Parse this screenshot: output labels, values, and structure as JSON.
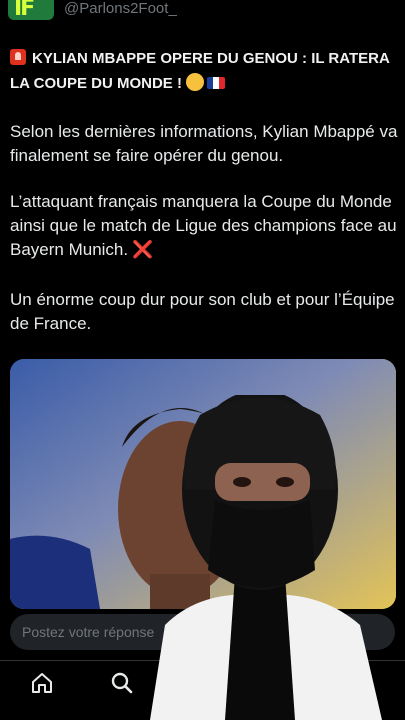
{
  "post": {
    "handle": "@Parlons2Foot_",
    "title": "KYLIAN MBAPPE OPERE DU GENOU : IL RATERA LA COUPE DU MONDE !",
    "paragraphs": [
      "Selon les dernières informations, Kylian Mbappé va finalement se faire opérer du genou.",
      "L’attaquant français manquera la Coupe du Monde ainsi que le match de Ligue des champions face au Bayern Munich.",
      "Un énorme coup dur pour son club et pour l’Équipe de France."
    ],
    "cross_mark": "❌"
  },
  "reply": {
    "placeholder": "Postez votre réponse"
  },
  "nav": {
    "icons": [
      "home-icon",
      "search-icon"
    ]
  },
  "colors": {
    "background": "#000000",
    "text": "#e7e9ea",
    "muted": "#71767b",
    "reply_bg": "#202327",
    "accent_red": "#e5322d"
  }
}
